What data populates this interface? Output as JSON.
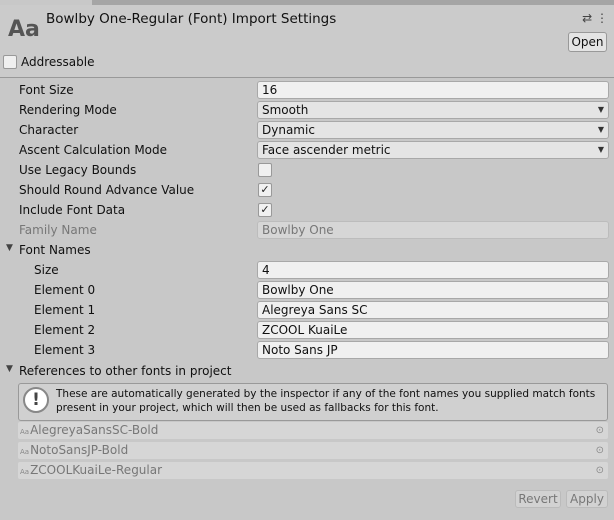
{
  "header": {
    "title": "Bowlby One-Regular (Font) Import Settings",
    "icon": "Aa",
    "open_label": "Open"
  },
  "addressable": {
    "label": "Addressable",
    "checked": false
  },
  "fields": {
    "font_size": {
      "label": "Font Size",
      "value": "16"
    },
    "rendering_mode": {
      "label": "Rendering Mode",
      "value": "Smooth"
    },
    "character": {
      "label": "Character",
      "value": "Dynamic"
    },
    "ascent": {
      "label": "Ascent Calculation Mode",
      "value": "Face ascender metric"
    },
    "legacy": {
      "label": "Use Legacy Bounds",
      "checked": false
    },
    "round": {
      "label": "Should Round Advance Value",
      "checked": true,
      "mark": "✓"
    },
    "include": {
      "label": "Include Font Data",
      "checked": true,
      "mark": "✓"
    },
    "family": {
      "label": "Family Name",
      "value": "Bowlby One"
    }
  },
  "font_names": {
    "label": "Font Names",
    "size_label": "Size",
    "size": "4",
    "elements": [
      {
        "label": "Element 0",
        "value": "Bowlby One"
      },
      {
        "label": "Element 1",
        "value": "Alegreya Sans SC"
      },
      {
        "label": "Element 2",
        "value": "ZCOOL KuaiLe"
      },
      {
        "label": "Element 3",
        "value": "Noto Sans JP"
      }
    ]
  },
  "references": {
    "label": "References to other fonts in project",
    "help": "These are automatically generated by the inspector if any of the font names you supplied match fonts present in your project, which will then be used as fallbacks for this font.",
    "items": [
      "AlegreyaSansSC-Bold",
      "NotoSansJP-Bold",
      "ZCOOLKuaiLe-Regular"
    ],
    "item_icon": "Aa"
  },
  "footer": {
    "revert": "Revert",
    "apply": "Apply"
  }
}
